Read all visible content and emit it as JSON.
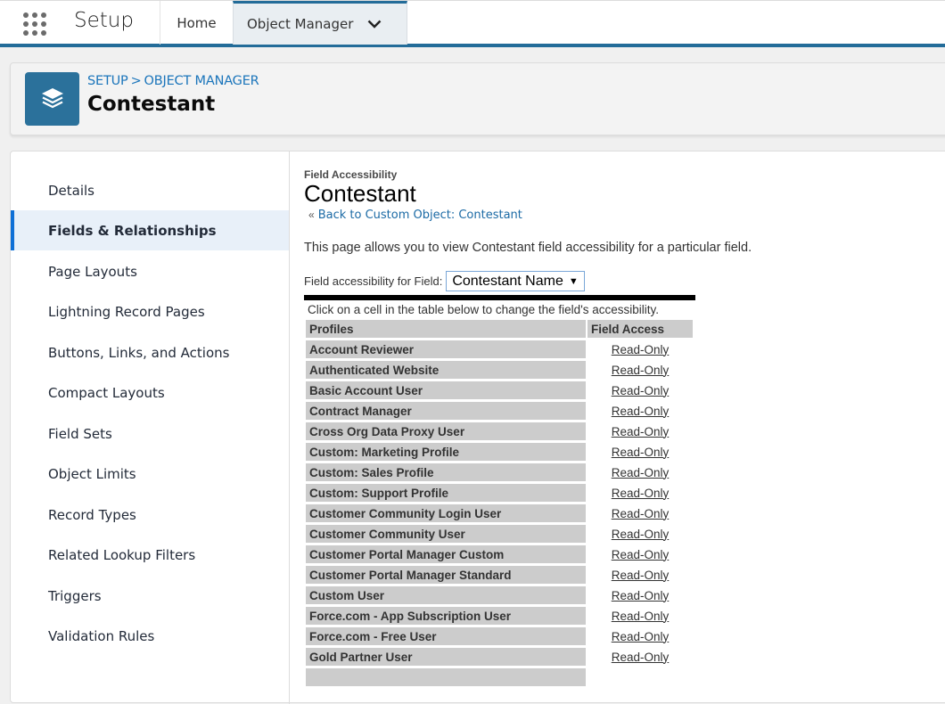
{
  "topbar": {
    "app_name": "Setup",
    "tabs": [
      {
        "label": "Home"
      },
      {
        "label": "Object Manager"
      }
    ]
  },
  "header": {
    "breadcrumb": [
      "SETUP",
      "OBJECT MANAGER"
    ],
    "breadcrumb_separator": ">",
    "title": "Contestant",
    "icon": "layers-icon",
    "icon_color": "#2b719b"
  },
  "sidebar": {
    "items": [
      {
        "label": "Details"
      },
      {
        "label": "Fields & Relationships",
        "active": true
      },
      {
        "label": "Page Layouts"
      },
      {
        "label": "Lightning Record Pages"
      },
      {
        "label": "Buttons, Links, and Actions"
      },
      {
        "label": "Compact Layouts"
      },
      {
        "label": "Field Sets"
      },
      {
        "label": "Object Limits"
      },
      {
        "label": "Record Types"
      },
      {
        "label": "Related Lookup Filters"
      },
      {
        "label": "Triggers"
      },
      {
        "label": "Validation Rules"
      }
    ]
  },
  "content": {
    "section_label": "Field Accessibility",
    "title": "Contestant",
    "back_prefix": "«",
    "back_link": "Back to Custom Object: Contestant",
    "description": "This page allows you to view Contestant field accessibility for a particular field.",
    "field_label": "Field accessibility for Field:",
    "field_value": "Contestant Name",
    "hint": "Click on a cell in the table below to change the field's accessibility.",
    "table": {
      "headers": [
        "Profiles",
        "Field Access"
      ],
      "rows": [
        {
          "profile": "Account Reviewer",
          "access": "Read-Only"
        },
        {
          "profile": "Authenticated Website",
          "access": "Read-Only"
        },
        {
          "profile": "Basic Account User",
          "access": "Read-Only"
        },
        {
          "profile": "Contract Manager",
          "access": "Read-Only"
        },
        {
          "profile": "Cross Org Data Proxy User",
          "access": "Read-Only"
        },
        {
          "profile": "Custom: Marketing Profile",
          "access": "Read-Only"
        },
        {
          "profile": "Custom: Sales Profile",
          "access": "Read-Only"
        },
        {
          "profile": "Custom: Support Profile",
          "access": "Read-Only"
        },
        {
          "profile": "Customer Community Login User",
          "access": "Read-Only"
        },
        {
          "profile": "Customer Community User",
          "access": "Read-Only"
        },
        {
          "profile": "Customer Portal Manager Custom",
          "access": "Read-Only"
        },
        {
          "profile": "Customer Portal Manager Standard",
          "access": "Read-Only"
        },
        {
          "profile": "Custom User",
          "access": "Read-Only"
        },
        {
          "profile": "Force.com - App Subscription User",
          "access": "Read-Only"
        },
        {
          "profile": "Force.com - Free User",
          "access": "Read-Only"
        },
        {
          "profile": "Gold Partner User",
          "access": "Read-Only"
        },
        {
          "profile": "",
          "access": ""
        }
      ]
    }
  }
}
